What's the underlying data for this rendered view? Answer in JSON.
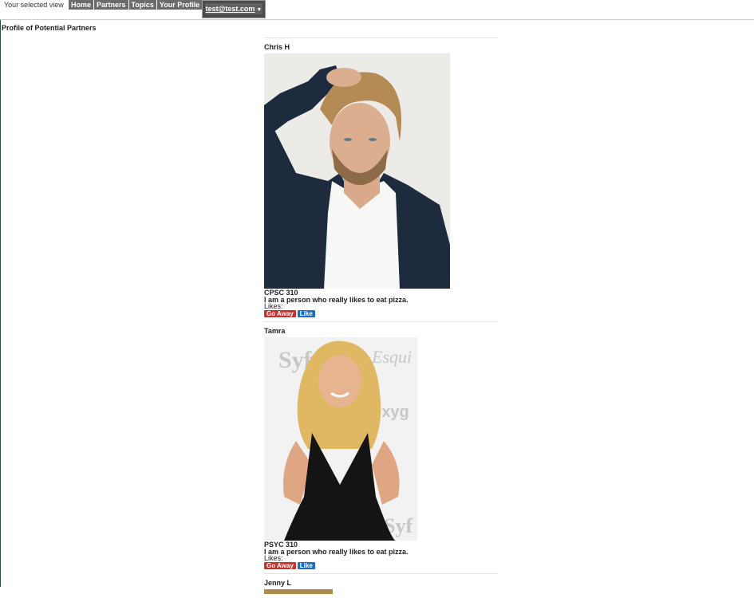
{
  "header": {
    "view_label": "Your selected view",
    "nav": [
      {
        "label": "Home"
      },
      {
        "label": "Partners"
      },
      {
        "label": "Topics"
      },
      {
        "label": "Your Profile"
      }
    ],
    "user_email": "test@test.com",
    "user_caret_icon": "caret-down-icon"
  },
  "page": {
    "title": "Profile of Potential Partners"
  },
  "profiles": [
    {
      "name": "Chris H",
      "course": "CPSC 310",
      "bio": "I am a person who really likes to eat pizza.",
      "likes_label": "Likes:",
      "go_away_label": "Go Away",
      "like_label": "Like"
    },
    {
      "name": "Tamra",
      "course": "PSYC 310",
      "bio": "I am a person who really likes to eat pizza.",
      "likes_label": "Likes:",
      "go_away_label": "Go Away",
      "like_label": "Like"
    },
    {
      "name": "Jenny L"
    }
  ],
  "colors": {
    "nav_bg": "#6b6b6b",
    "user_menu_bg": "#4a4a4a",
    "go_away": "#c9302c",
    "like": "#1a6fc2"
  }
}
